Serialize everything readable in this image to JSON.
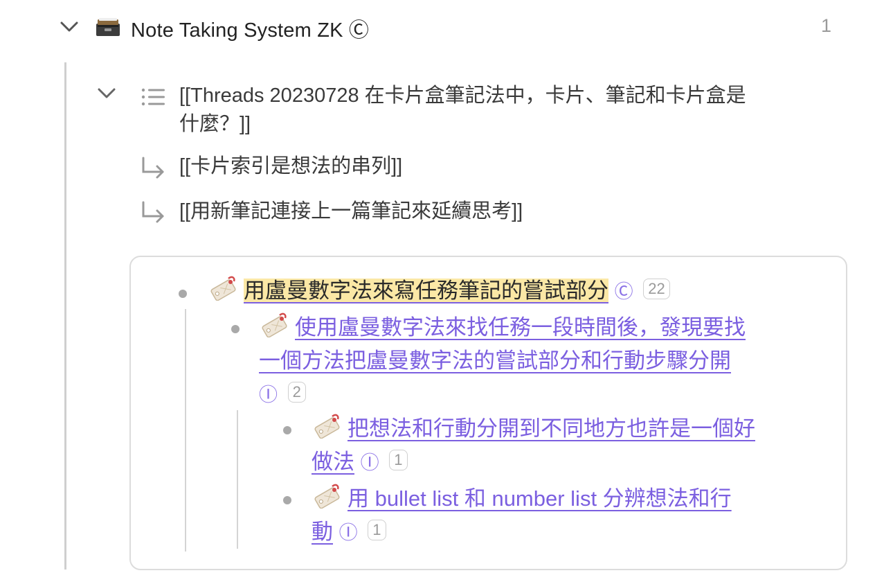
{
  "header": {
    "title": "Note Taking System ZK Ⓒ",
    "count": "1",
    "icon": "file-cabinet-icon"
  },
  "refs": {
    "main_link": "[[Threads 20230728 在卡片盒筆記法中，卡片、筆記和卡片盒是什麼？]]",
    "main_link_line1": "[[Threads 20230728 在卡片盒筆記法中，卡片、筆記和卡片盒是",
    "main_link_line2": "什麼？]]",
    "child1": "[[卡片索引是想法的串列]]",
    "child2": "[[用新筆記連接上一篇筆記來延續思考]]"
  },
  "card": {
    "root": {
      "title": "用盧曼數字法來寫任務筆記的嘗試部分",
      "tag": "Ⓒ",
      "count": "22"
    },
    "child": {
      "title_line1": "使用盧曼數字法來找任務一段時間後，發現要找",
      "title_line2": "一個方法把盧曼數字法的嘗試部分和行動步驟分開",
      "tag": "Ⓘ",
      "count": "2"
    },
    "grandchildren": [
      {
        "line1": "把想法和行動分開到不同地方也許是一個好",
        "line2": "做法",
        "tag": "Ⓘ",
        "count": "1"
      },
      {
        "line1": "用 bullet list 和 number list 分辨想法和行",
        "line2": "動",
        "tag": "Ⓘ",
        "count": "1"
      }
    ]
  },
  "colors": {
    "link": "#7b5fe0",
    "highlight": "#fbe8a6",
    "muted": "#9a9a9a"
  }
}
